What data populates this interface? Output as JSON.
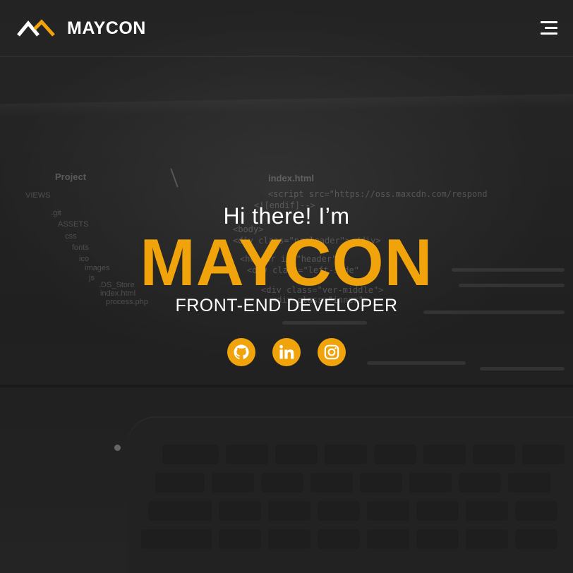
{
  "brand": {
    "name": "MAYCON",
    "accent_color": "#f0a30a",
    "logo_icon": "mountain-logo-icon"
  },
  "header": {
    "menu_icon": "hamburger-menu-icon"
  },
  "hero": {
    "greeting": "Hi there! I’m",
    "name": "MAYCON",
    "role": "FRONT-END DEVELOPER"
  },
  "social": [
    {
      "name": "GitHub",
      "icon": "github-icon"
    },
    {
      "name": "LinkedIn",
      "icon": "linkedin-icon"
    },
    {
      "name": "Instagram",
      "icon": "instagram-icon"
    }
  ],
  "background": {
    "sidebar_title": "Project",
    "views_label": "VIEWS",
    "tree": [
      ".git",
      "ASSETS",
      "css",
      "fonts",
      "ico",
      "images",
      "js",
      ".DS_Store",
      "index.html",
      "process.php"
    ],
    "file_tab": "index.html",
    "code_lines": [
      "<script src=\"https://oss.maxcdn.com/respond",
      "<![endif]-->",
      "<body>",
      "<div class=\"preloader\"></div>",
      "<header id=\"header\">",
      "<div class=\"left-side\"",
      "<div class=\"ver-middle\">",
      "<div class=\"inner\">"
    ]
  }
}
